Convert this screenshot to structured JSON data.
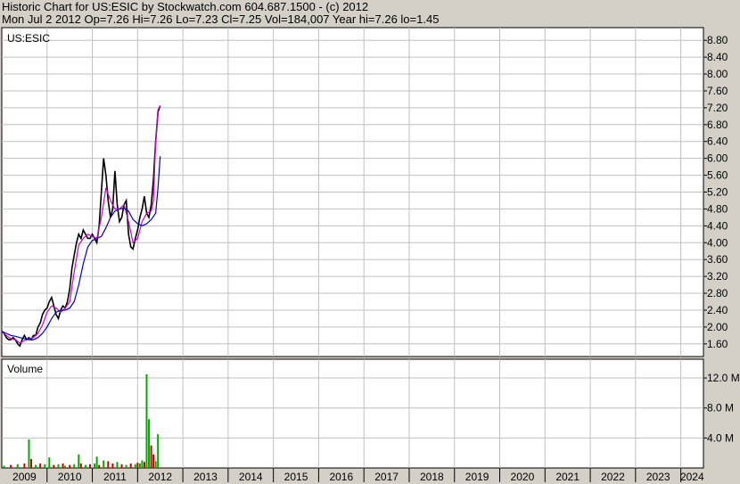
{
  "header": {
    "line1": "Historic Chart for US:ESIC by Stockwatch.com 604.687.1500 - (c) 2012",
    "line2": "Mon Jul  2 2012  Op=7.26  Hi=7.26  Lo=7.23  Cl=7.25  Vol=184,007  Year hi=7.26  lo=1.45"
  },
  "colors": {
    "background": "#d4d0c8",
    "plot_bg": "#ffffff",
    "grid": "#c0c0c0",
    "price": "#000000",
    "ma_short": "#cc00cc",
    "ma_long": "#0000cc",
    "volume_up": "#00aa00",
    "volume_down": "#cc0000"
  },
  "chart_data": [
    {
      "type": "line",
      "title": "US:ESIC",
      "xlabel": "",
      "ylabel": "",
      "x_ticks": [
        "2009",
        "2010",
        "2011",
        "2012",
        "2013",
        "2014",
        "2015",
        "2016",
        "2017",
        "2018",
        "2019",
        "2020",
        "2021",
        "2022",
        "2023",
        "2024"
      ],
      "xlim": [
        2009.0,
        2024.5
      ],
      "y_ticks": [
        1.6,
        2.0,
        2.4,
        2.8,
        3.2,
        3.6,
        4.0,
        4.4,
        4.8,
        5.2,
        5.6,
        6.0,
        6.4,
        6.8,
        7.2,
        7.6,
        8.0,
        8.4,
        8.8
      ],
      "ylim": [
        1.3,
        9.1
      ],
      "grid": true,
      "series": [
        {
          "role": "price",
          "x": [
            2009.0,
            2009.05,
            2009.1,
            2009.15,
            2009.2,
            2009.25,
            2009.3,
            2009.35,
            2009.4,
            2009.45,
            2009.5,
            2009.55,
            2009.6,
            2009.65,
            2009.7,
            2009.75,
            2009.8,
            2009.85,
            2009.9,
            2009.95,
            2010.0,
            2010.05,
            2010.1,
            2010.15,
            2010.2,
            2010.25,
            2010.3,
            2010.35,
            2010.4,
            2010.45,
            2010.5,
            2010.55,
            2010.6,
            2010.65,
            2010.7,
            2010.75,
            2010.8,
            2010.85,
            2010.9,
            2010.95,
            2011.0,
            2011.05,
            2011.1,
            2011.15,
            2011.2,
            2011.25,
            2011.3,
            2011.35,
            2011.4,
            2011.45,
            2011.5,
            2011.55,
            2011.6,
            2011.65,
            2011.7,
            2011.75,
            2011.8,
            2011.85,
            2011.9,
            2011.95,
            2012.0,
            2012.05,
            2012.1,
            2012.15,
            2012.2,
            2012.25,
            2012.3,
            2012.35,
            2012.4,
            2012.45,
            2012.5
          ],
          "y": [
            1.9,
            1.85,
            1.75,
            1.7,
            1.7,
            1.75,
            1.7,
            1.6,
            1.55,
            1.7,
            1.8,
            1.7,
            1.75,
            1.7,
            1.8,
            1.8,
            2.0,
            2.1,
            2.3,
            2.4,
            2.45,
            2.6,
            2.7,
            2.5,
            2.3,
            2.2,
            2.4,
            2.5,
            2.45,
            2.6,
            2.9,
            3.4,
            3.7,
            4.0,
            4.2,
            4.1,
            4.3,
            4.2,
            4.1,
            4.1,
            4.2,
            4.1,
            4.0,
            4.4,
            5.2,
            6.0,
            5.6,
            5.0,
            4.6,
            4.8,
            5.7,
            4.9,
            4.5,
            4.6,
            4.9,
            5.0,
            4.2,
            3.9,
            3.85,
            4.1,
            4.3,
            4.6,
            4.8,
            5.1,
            4.7,
            4.6,
            4.9,
            5.5,
            6.4,
            7.1,
            7.25
          ]
        },
        {
          "role": "ma_short",
          "x": [
            2009.0,
            2009.1,
            2009.2,
            2009.3,
            2009.4,
            2009.5,
            2009.6,
            2009.7,
            2009.8,
            2009.9,
            2010.0,
            2010.1,
            2010.2,
            2010.3,
            2010.4,
            2010.5,
            2010.6,
            2010.7,
            2010.8,
            2010.9,
            2011.0,
            2011.1,
            2011.2,
            2011.3,
            2011.4,
            2011.5,
            2011.6,
            2011.7,
            2011.8,
            2011.9,
            2012.0,
            2012.1,
            2012.2,
            2012.3,
            2012.35,
            2012.4,
            2012.45,
            2012.5
          ],
          "y": [
            1.9,
            1.8,
            1.72,
            1.7,
            1.62,
            1.68,
            1.72,
            1.75,
            1.85,
            2.05,
            2.35,
            2.5,
            2.45,
            2.35,
            2.45,
            2.6,
            3.3,
            3.95,
            4.1,
            4.2,
            4.15,
            4.1,
            4.6,
            5.3,
            5.0,
            4.8,
            4.8,
            4.9,
            4.5,
            4.0,
            4.1,
            4.5,
            4.7,
            4.75,
            5.0,
            6.4,
            7.15,
            7.25
          ]
        },
        {
          "role": "ma_long",
          "x": [
            2009.0,
            2009.1,
            2009.2,
            2009.3,
            2009.4,
            2009.5,
            2009.6,
            2009.7,
            2009.8,
            2009.9,
            2010.0,
            2010.1,
            2010.2,
            2010.3,
            2010.4,
            2010.5,
            2010.6,
            2010.7,
            2010.8,
            2010.9,
            2011.0,
            2011.1,
            2011.2,
            2011.3,
            2011.4,
            2011.5,
            2011.6,
            2011.7,
            2011.8,
            2011.9,
            2012.0,
            2012.1,
            2012.2,
            2012.3,
            2012.4,
            2012.45,
            2012.5
          ],
          "y": [
            1.9,
            1.85,
            1.8,
            1.78,
            1.75,
            1.72,
            1.7,
            1.7,
            1.75,
            1.85,
            2.0,
            2.2,
            2.35,
            2.4,
            2.4,
            2.45,
            2.6,
            3.0,
            3.5,
            3.9,
            4.05,
            4.1,
            4.15,
            4.35,
            4.6,
            4.75,
            4.8,
            4.82,
            4.75,
            4.55,
            4.45,
            4.4,
            4.45,
            4.55,
            4.7,
            5.3,
            6.05
          ]
        }
      ]
    },
    {
      "type": "bar",
      "title": "Volume",
      "xlabel": "",
      "ylabel": "",
      "y_ticks": [
        "4.0 M",
        "8.0 M",
        "12.0 M"
      ],
      "y_tick_values": [
        4.0,
        8.0,
        12.0
      ],
      "ylim": [
        0,
        14.5
      ],
      "unit": "M",
      "grid": true,
      "series": [
        {
          "role": "volume",
          "x": [
            2009.05,
            2009.2,
            2009.35,
            2009.5,
            2009.6,
            2009.65,
            2009.75,
            2009.85,
            2009.95,
            2010.05,
            2010.15,
            2010.25,
            2010.35,
            2010.4,
            2010.5,
            2010.6,
            2010.7,
            2010.75,
            2010.85,
            2010.95,
            2011.05,
            2011.1,
            2011.15,
            2011.25,
            2011.35,
            2011.45,
            2011.55,
            2011.65,
            2011.75,
            2011.85,
            2011.95,
            2012.0,
            2012.05,
            2012.1,
            2012.15,
            2012.2,
            2012.25,
            2012.3,
            2012.35,
            2012.4,
            2012.45
          ],
          "values": [
            0.3,
            0.4,
            0.5,
            0.6,
            3.8,
            1.2,
            0.4,
            0.6,
            0.5,
            1.4,
            0.4,
            0.5,
            0.6,
            0.3,
            0.4,
            0.5,
            1.8,
            0.6,
            0.4,
            0.5,
            0.6,
            1.5,
            0.4,
            1.0,
            0.9,
            0.6,
            0.8,
            0.5,
            0.4,
            0.6,
            0.5,
            0.7,
            0.6,
            1.0,
            0.8,
            12.5,
            6.5,
            3.0,
            1.8,
            0.9,
            4.5
          ],
          "up": [
            true,
            false,
            true,
            false,
            true,
            false,
            true,
            false,
            true,
            true,
            false,
            true,
            false,
            true,
            false,
            true,
            true,
            false,
            true,
            false,
            true,
            true,
            false,
            true,
            false,
            false,
            true,
            false,
            true,
            false,
            true,
            false,
            true,
            true,
            false,
            true,
            true,
            false,
            false,
            true,
            true
          ]
        }
      ]
    }
  ]
}
